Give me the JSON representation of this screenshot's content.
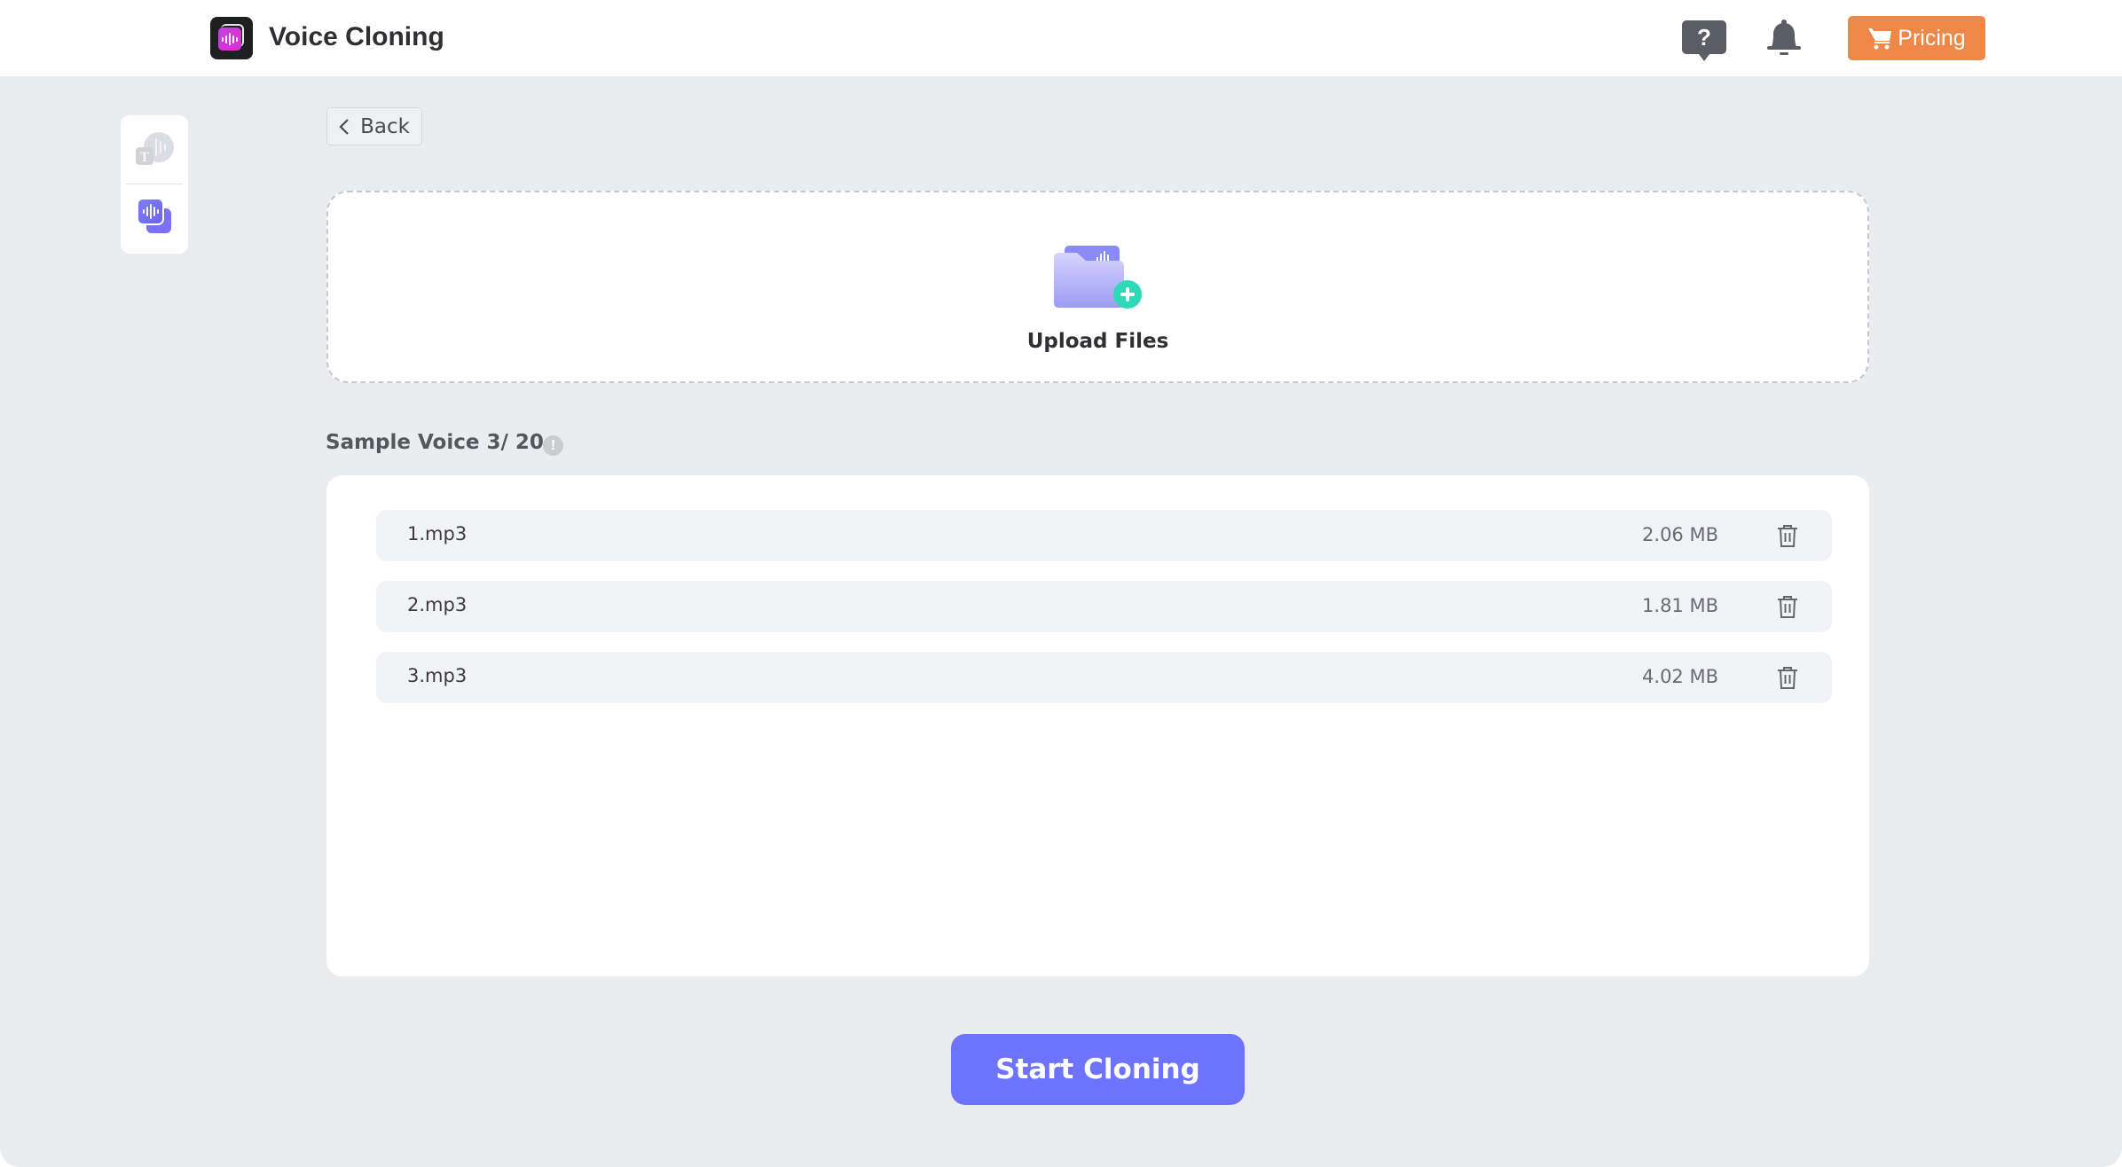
{
  "header": {
    "app_title": "Voice Cloning",
    "help_icon_label": "?",
    "pricing_label": "Pricing"
  },
  "sidebar": {
    "items": [
      {
        "name": "text-to-speech",
        "active": false
      },
      {
        "name": "voice-cloning",
        "active": true
      }
    ]
  },
  "back_label": "Back",
  "upload": {
    "label": "Upload Files"
  },
  "sample": {
    "heading": "Sample Voice 3/ 20",
    "count": 3,
    "max": 20,
    "info_icon_label": "!"
  },
  "files": [
    {
      "name": "1.mp3",
      "size": "2.06 MB"
    },
    {
      "name": "2.mp3",
      "size": "1.81 MB"
    },
    {
      "name": "3.mp3",
      "size": "4.02 MB"
    }
  ],
  "start_button_label": "Start Cloning",
  "colors": {
    "accent": "#6e73fd",
    "pricing": "#ef8748",
    "background": "#ebecf0",
    "upload_plus": "#2fd9b8"
  }
}
